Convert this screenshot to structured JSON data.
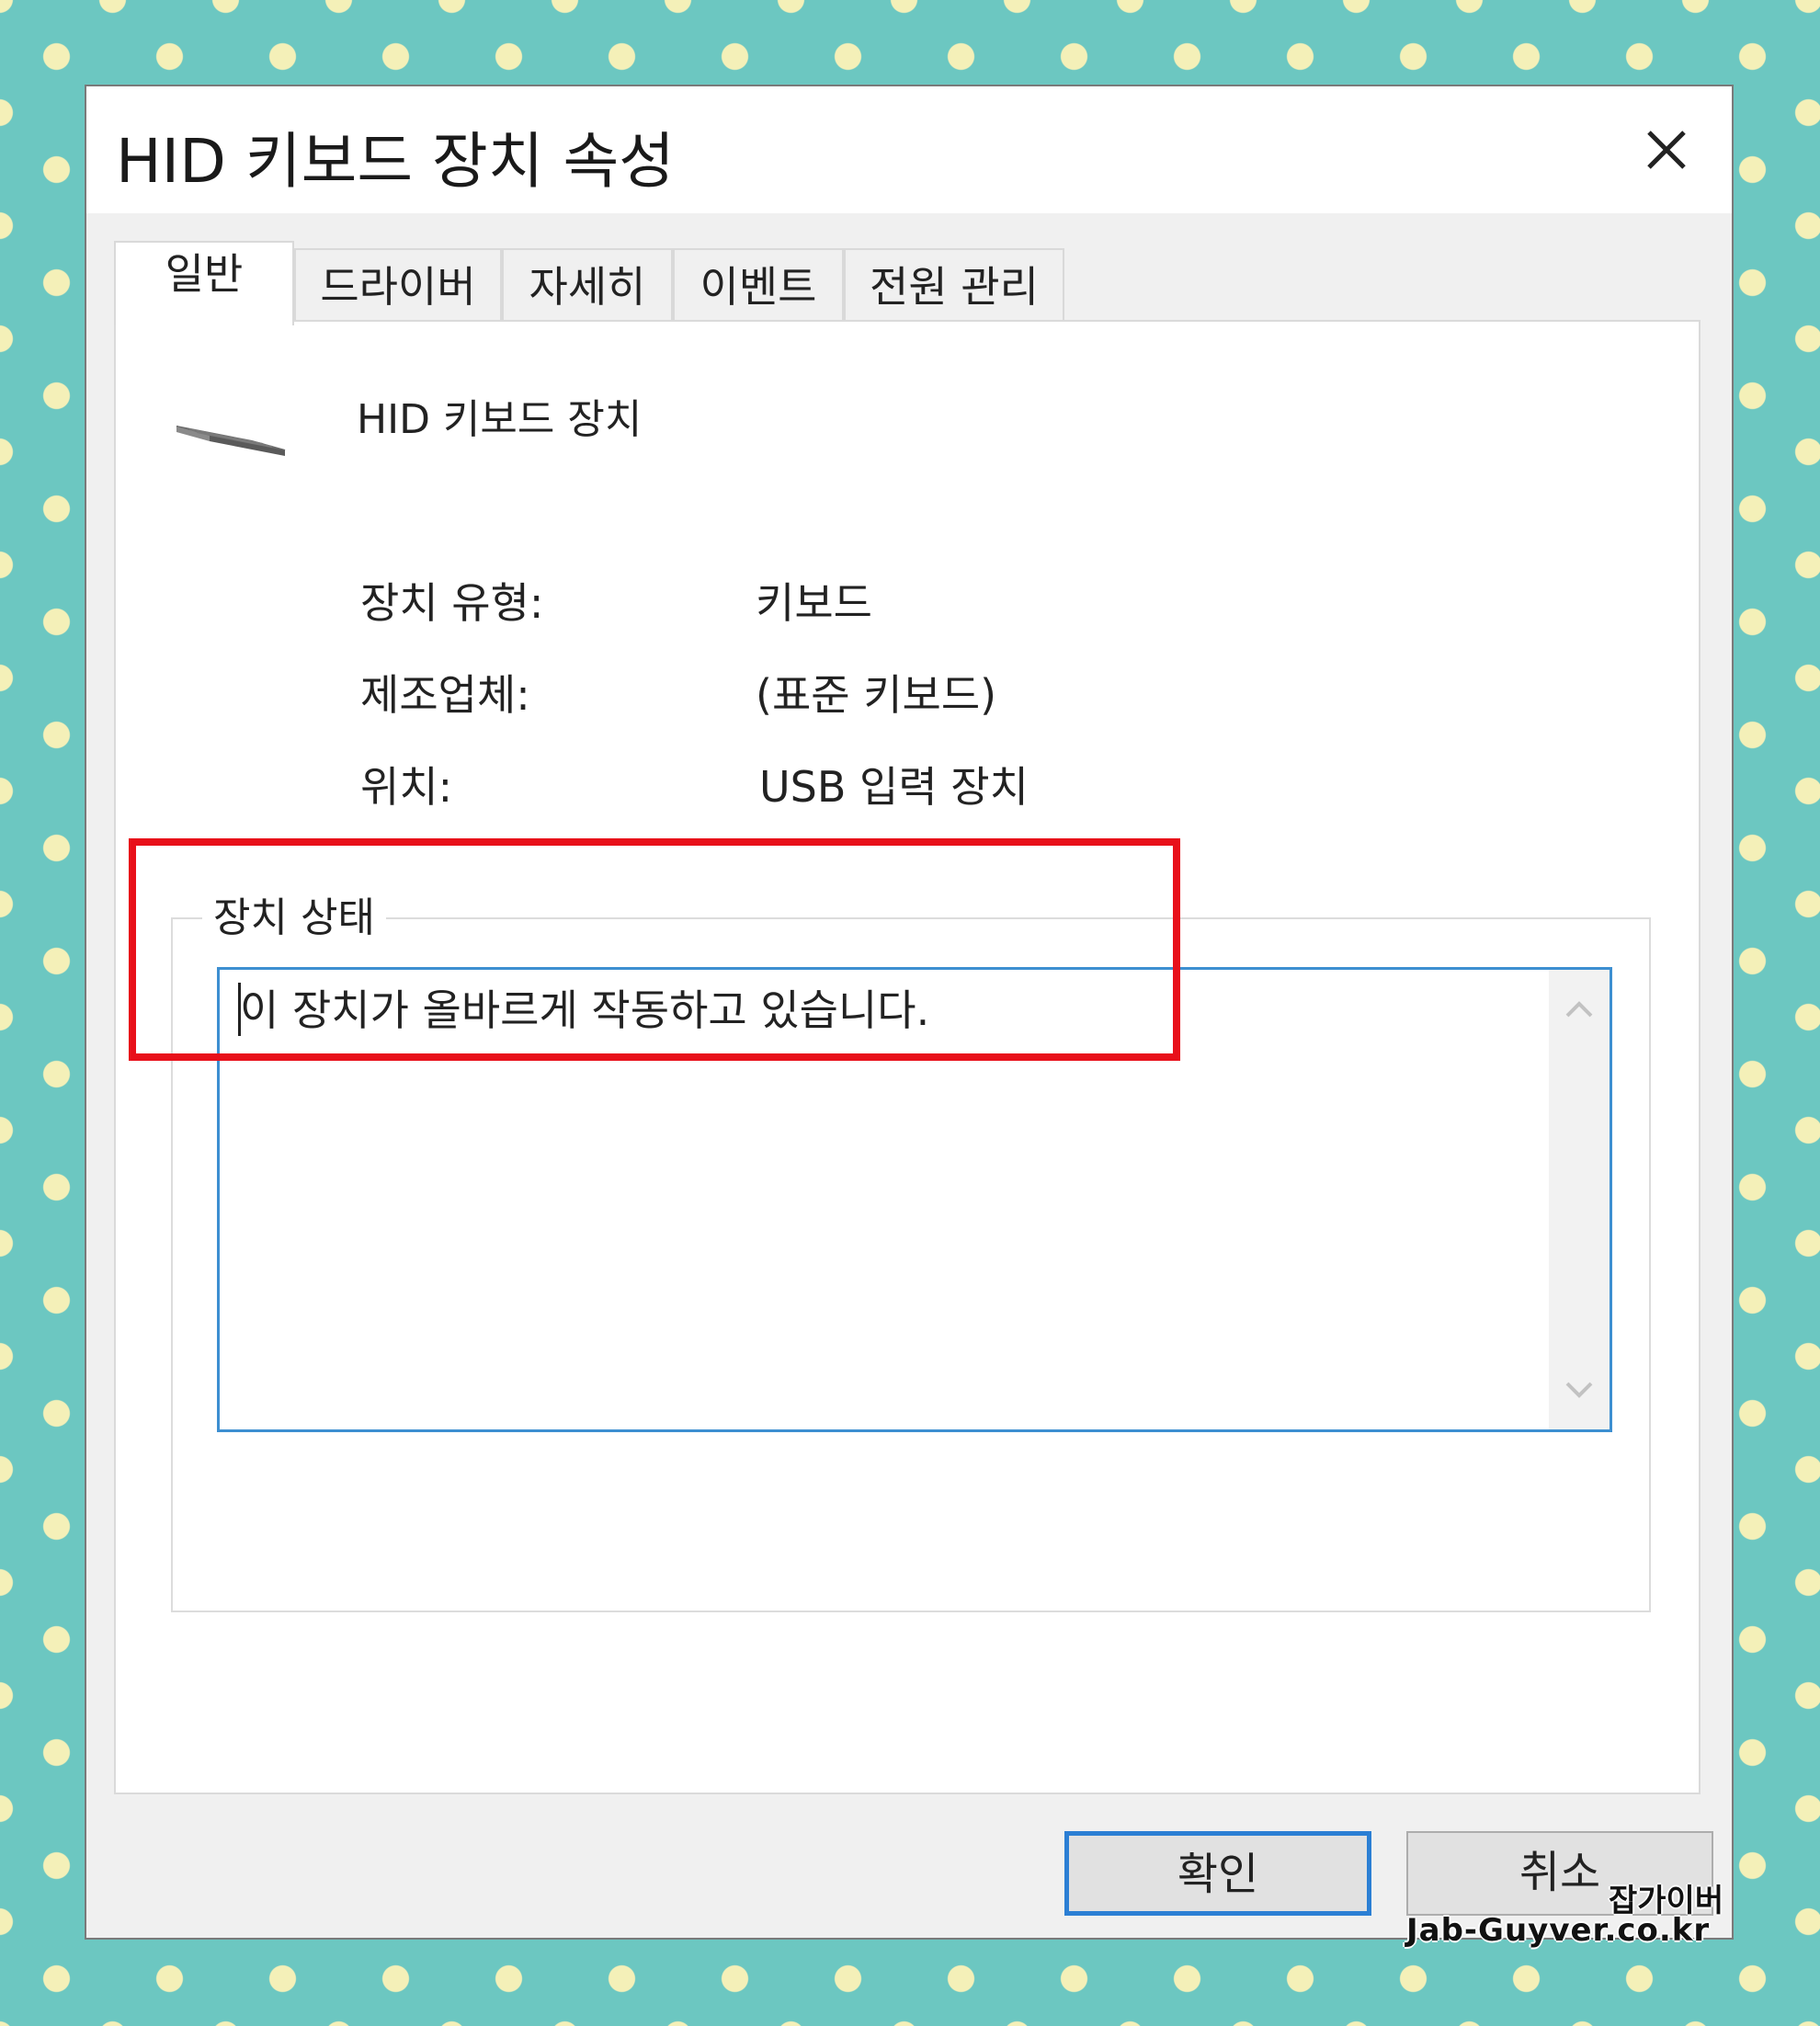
{
  "window": {
    "title": "HID 키보드 장치 속성"
  },
  "tabs": [
    {
      "label": "일반",
      "active": true
    },
    {
      "label": "드라이버",
      "active": false
    },
    {
      "label": "자세히",
      "active": false
    },
    {
      "label": "이벤트",
      "active": false
    },
    {
      "label": "전원 관리",
      "active": false
    }
  ],
  "general": {
    "device_name": "HID 키보드 장치",
    "device_icon": "keyboard-icon",
    "properties": [
      {
        "label": "장치 유형:",
        "value": "키보드"
      },
      {
        "label": "제조업체:",
        "value": "(표준 키보드)"
      },
      {
        "label": "위치:",
        "value": "USB 입력 장치"
      }
    ],
    "status_group_label": "장치 상태",
    "status_text": "이 장치가 올바르게 작동하고 있습니다."
  },
  "buttons": {
    "ok_label": "확인",
    "cancel_label": "취소"
  },
  "watermark": {
    "line1": "잡가이버",
    "line2": "Jab-Guyver.co.kr"
  },
  "colors": {
    "background": "#6cc7c1",
    "polka_dot": "#f4f0b8",
    "highlight": "#e8101a",
    "focus_border": "#3d8fd1"
  }
}
